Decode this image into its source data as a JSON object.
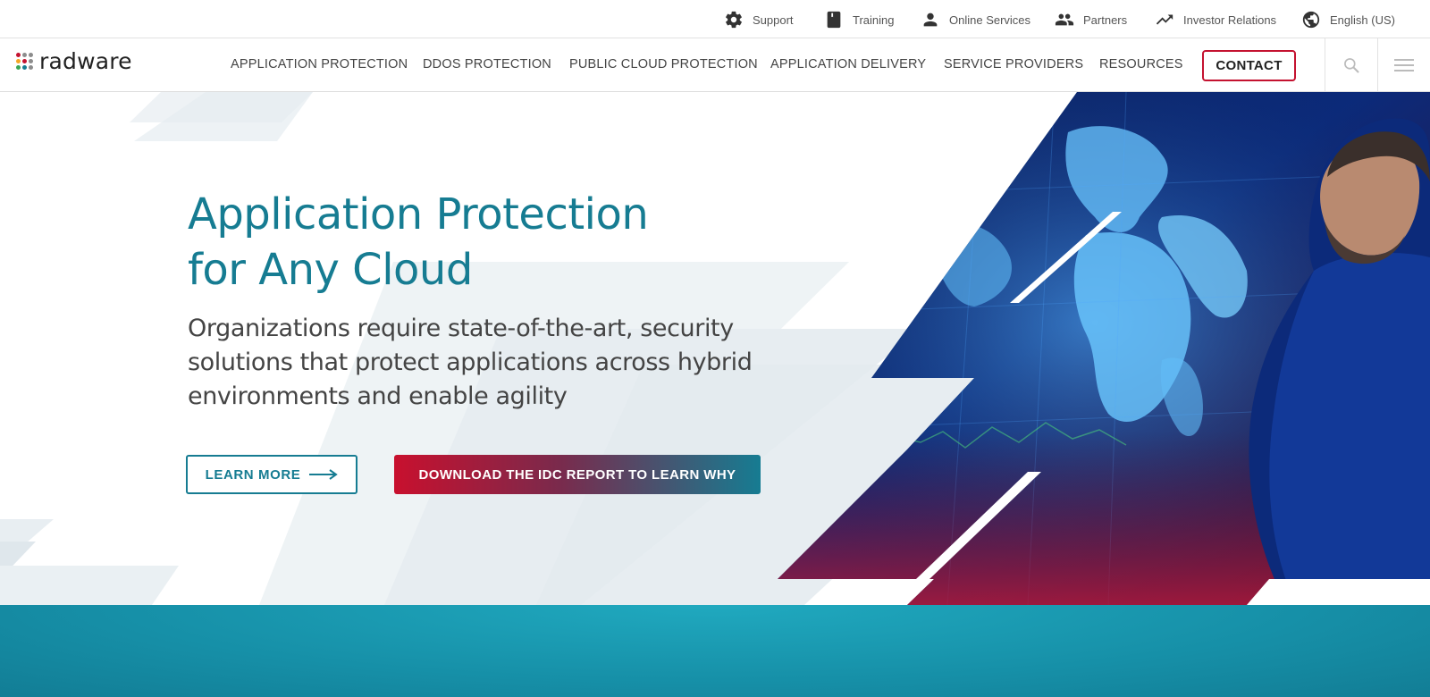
{
  "utility_nav": {
    "items": [
      {
        "label": "Support",
        "icon": "gear-icon"
      },
      {
        "label": "Training",
        "icon": "book-icon"
      },
      {
        "label": "Online Services",
        "icon": "person-icon"
      },
      {
        "label": "Partners",
        "icon": "people-icon"
      },
      {
        "label": "Investor Relations",
        "icon": "trending-up-icon"
      },
      {
        "label": "English (US)",
        "icon": "globe-icon"
      }
    ]
  },
  "brand": {
    "logo_text": "radware",
    "dot_colors": [
      "#c41230",
      "#8c8c8c",
      "#8c8c8c",
      "#f5a623",
      "#c41230",
      "#8c8c8c",
      "#3aa655",
      "#167c92",
      "#8c8c8c"
    ]
  },
  "main_nav": {
    "links": [
      "APPLICATION PROTECTION",
      "DDOS PROTECTION",
      "PUBLIC CLOUD PROTECTION",
      "APPLICATION DELIVERY",
      "SERVICE PROVIDERS",
      "RESOURCES"
    ],
    "contact_label": "CONTACT",
    "search_icon": "search-icon",
    "menu_icon": "hamburger-menu-icon"
  },
  "hero": {
    "title_line1": "Application Protection",
    "title_line2": "for Any Cloud",
    "subtitle_line1": "Organizations require state-of-the-art, security",
    "subtitle_line2": "solutions that protect applications across hybrid",
    "subtitle_line3": "environments and enable agility",
    "learn_more_label": "LEARN MORE",
    "learn_more_icon": "arrow-right-icon",
    "download_label": "DOWNLOAD THE IDC REPORT TO LEARN WHY"
  },
  "colors": {
    "brand_teal": "#167c92",
    "brand_red": "#c41230",
    "band_teal": "#1a9bb3"
  }
}
